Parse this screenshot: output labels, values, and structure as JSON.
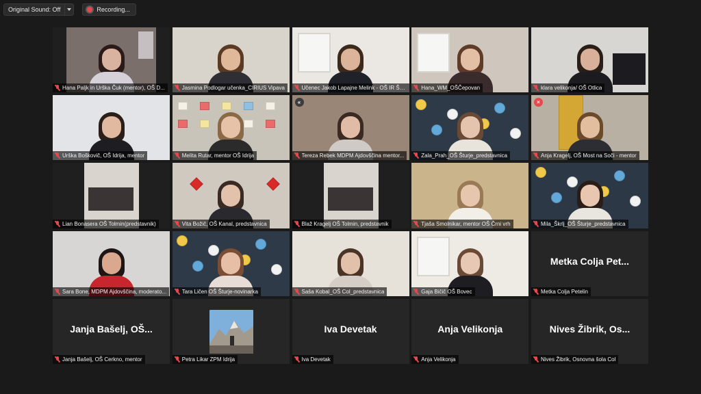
{
  "topbar": {
    "original_sound_label": "Original Sound: Off",
    "recording_label": "Recording..."
  },
  "participants": [
    {
      "name": "Hana Paljk in Urška Čuk (mentor), OŠ D...",
      "muted": true,
      "scene": {
        "wall": "#7b6f6c",
        "hair": "#2a1a18",
        "face": "#d9b39f",
        "shirt": "#d6d0d8"
      }
    },
    {
      "name": "Jasmina Podlogar učenka_CIRIUS Vipava",
      "muted": true,
      "scene": {
        "wall": "#d8d4cc",
        "hair": "#5a3a22",
        "face": "#e0b89a",
        "shirt": "#2e2e34"
      }
    },
    {
      "name": "Učenec Jakob Lapajne Melink - OŠ IR Še...",
      "muted": true,
      "scene": {
        "wall": "#ebe8e3",
        "hair": "#3b2a1c",
        "face": "#dcb49a",
        "shirt": "#1f2228"
      }
    },
    {
      "name": "Hana_WM_OŠČepovan",
      "muted": true,
      "scene": {
        "wall": "#cfc7bd",
        "hair": "#5e3c28",
        "face": "#e3bfa6",
        "shirt": "#3a2c2c"
      }
    },
    {
      "name": "klara velikonja/ OŠ Otlica",
      "muted": true,
      "scene": {
        "wall": "#d7d6d2",
        "hair": "#2a1e18",
        "face": "#d9b09a",
        "shirt": "#1c1c20"
      }
    },
    {
      "name": "Urška Boškovič, OŠ Idrija, mentor",
      "muted": true,
      "scene": {
        "wall": "#e2e4e8",
        "hair": "#2b1d18",
        "face": "#e1b8a0",
        "shirt": "#1e1e22"
      }
    },
    {
      "name": "Melita Rutar, mentor OŠ Idrija",
      "muted": true,
      "scene": {
        "wall": "#c9c4ba",
        "hair": "#8a6a46",
        "face": "#e6c3a8",
        "shirt": "#2b2b2b"
      }
    },
    {
      "name": "Tereza Rebek MDPM Ajdovščina mentor...",
      "muted": true,
      "scene": {
        "wall": "#9a8676",
        "hair": "#3a2a22",
        "face": "#e0bca6",
        "shirt": "#cfcac6"
      }
    },
    {
      "name": "Zala_Prah_OŠ Šturje_predstavnica",
      "muted": true,
      "scene": {
        "wall": "#2f3a48",
        "hair": "#6a4a34",
        "face": "#e5c4ae",
        "shirt": "#e8e4dc"
      }
    },
    {
      "name": "Anja Kragelj, OŠ Most na Soči - mentor",
      "muted": true,
      "scene": {
        "wall": "#b8b0a2",
        "hair": "#6a4a2a",
        "face": "#e2be9f",
        "shirt": "#2c2e34"
      }
    },
    {
      "name": "Lian Bonasera OŠ Tolmin(predstavnik)",
      "muted": true,
      "scene": {
        "wall": "#b8a89a",
        "hair": "#000000",
        "face": "#000000",
        "shirt": "#000000"
      }
    },
    {
      "name": "Vita Božič, OŠ Kanal, predstavnica",
      "muted": true,
      "scene": {
        "wall": "#cfc9c0",
        "hair": "#3a2a24",
        "face": "#e3c2ac",
        "shirt": "#2a2a2e"
      }
    },
    {
      "name": "Blaž Kragelj OŠ Tolmin, predstavnik",
      "muted": true,
      "scene": {
        "wall": "#a89888",
        "hair": "#000000",
        "face": "#000000",
        "shirt": "#000000"
      }
    },
    {
      "name": "Tjaša Smolnikar, mentor OŠ Črni vrh",
      "muted": true,
      "scene": {
        "wall": "#c9b48c",
        "hair": "#9a7a56",
        "face": "#e6c6ac",
        "shirt": "#f2eee8"
      }
    },
    {
      "name": "Mila_Škrlj_OŠ Šturje_predstavnica",
      "muted": true,
      "scene": {
        "wall": "#2c3846",
        "hair": "#2a1c16",
        "face": "#e8c6b0",
        "shirt": "#e9e6e0"
      }
    },
    {
      "name": "Sara Bone, MDPM Ajdovščina, moderato...",
      "muted": true,
      "scene": {
        "wall": "#d8d6d4",
        "hair": "#1e1614",
        "face": "#d9a88e",
        "shirt": "#c8262e"
      }
    },
    {
      "name": "Tara Ličen OŠ Šturje-novinarka",
      "muted": true,
      "scene": {
        "wall": "#2e3a48",
        "hair": "#7a4e34",
        "face": "#e6bfa6",
        "shirt": "#e8dcd6"
      }
    },
    {
      "name": "Saša Kobal_OŠ Col_predstavnica",
      "muted": true,
      "scene": {
        "wall": "#e6e2da",
        "hair": "#4a3428",
        "face": "#e2c1aa",
        "shirt": "#d5cec6"
      }
    },
    {
      "name": "Gaja Bičič OŠ Bovec",
      "muted": true,
      "scene": {
        "wall": "#eeeae4",
        "hair": "#6a4a36",
        "face": "#e6c8b4",
        "shirt": "#1e1e22"
      }
    },
    {
      "name": "Metka Colja Petelin",
      "muted": true,
      "big_name": "Metka Colja Pet..."
    },
    {
      "name": "Janja Bašelj, OŠ Cerkno, mentor",
      "muted": true,
      "big_name": "Janja Bašelj, OŠ..."
    },
    {
      "name": "Petra Likar ZPM Idrija",
      "muted": true,
      "avatar": "mountain-photo"
    },
    {
      "name": "Iva Devetak",
      "muted": true,
      "big_name": "Iva Devetak"
    },
    {
      "name": "Anja Velikonja",
      "muted": true,
      "big_name": "Anja Velikonja"
    },
    {
      "name": "Nives Žibrik, Osnovna šola Col",
      "muted": true,
      "big_name": "Nives Žibrik, Os..."
    }
  ]
}
